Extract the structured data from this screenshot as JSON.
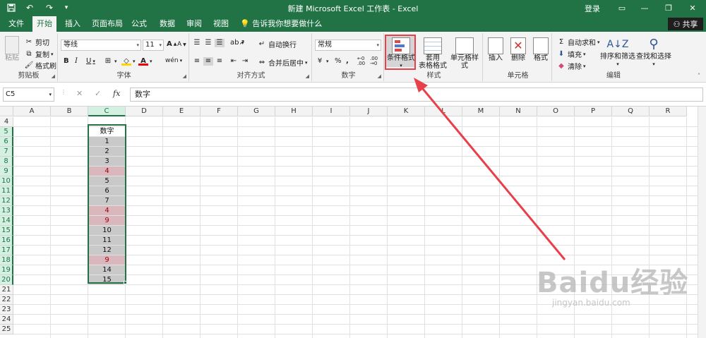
{
  "title_bar": {
    "title": "新建 Microsoft Excel 工作表 - Excel",
    "login": "登录",
    "quick_access": [
      "save-icon",
      "undo-icon",
      "redo-icon",
      "customize-icon"
    ]
  },
  "tabs": [
    "文件",
    "开始",
    "插入",
    "页面布局",
    "公式",
    "数据",
    "审阅",
    "视图"
  ],
  "active_tab": "开始",
  "tell_me": "告诉我你想要做什么",
  "share": "共享",
  "ribbon": {
    "clipboard": {
      "label": "剪贴板",
      "paste": "粘贴",
      "cut": "剪切",
      "copy": "复制",
      "format_painter": "格式刷"
    },
    "font": {
      "label": "字体",
      "font_name": "等线",
      "font_size": "11",
      "bold": "B",
      "italic": "I",
      "underline": "U",
      "grow": "A",
      "shrink": "A",
      "wen": "wén"
    },
    "alignment": {
      "label": "对齐方式",
      "wrap": "自动换行",
      "merge": "合并后居中"
    },
    "number": {
      "label": "数字",
      "format": "常规",
      "percent": "%",
      "comma": ",",
      "inc": "←0 .00",
      "dec": ".00 →0"
    },
    "styles": {
      "label": "样式",
      "conditional": "条件格式",
      "table_line1": "套用",
      "table_line2": "表格格式",
      "cell_styles": "单元格样式"
    },
    "cells": {
      "label": "单元格",
      "insert": "插入",
      "delete": "删除",
      "format": "格式"
    },
    "editing": {
      "label": "编辑",
      "autosum": "自动求和",
      "fill": "填充",
      "clear": "清除",
      "sort": "排序和筛选",
      "find": "查找和选择"
    }
  },
  "formula_bar": {
    "name_box": "C5",
    "formula": "数字",
    "fx": "fx"
  },
  "columns": [
    "A",
    "B",
    "C",
    "D",
    "E",
    "F",
    "G",
    "H",
    "I",
    "J",
    "K",
    "L",
    "M",
    "N",
    "O",
    "P",
    "Q",
    "R"
  ],
  "rows": [
    "4",
    "5",
    "6",
    "7",
    "8",
    "9",
    "10",
    "11",
    "12",
    "13",
    "14",
    "15",
    "16",
    "17",
    "18",
    "19",
    "20",
    "21",
    "22",
    "23",
    "24",
    "25"
  ],
  "selected_column": "C",
  "data_cells": [
    {
      "row": "5",
      "value": "数字",
      "style": "header"
    },
    {
      "row": "6",
      "value": "1",
      "style": "normal"
    },
    {
      "row": "7",
      "value": "2",
      "style": "normal"
    },
    {
      "row": "8",
      "value": "3",
      "style": "normal"
    },
    {
      "row": "9",
      "value": "4",
      "style": "hl"
    },
    {
      "row": "10",
      "value": "5",
      "style": "normal"
    },
    {
      "row": "11",
      "value": "6",
      "style": "normal"
    },
    {
      "row": "12",
      "value": "7",
      "style": "normal"
    },
    {
      "row": "13",
      "value": "4",
      "style": "hl"
    },
    {
      "row": "14",
      "value": "9",
      "style": "hl"
    },
    {
      "row": "15",
      "value": "10",
      "style": "normal"
    },
    {
      "row": "16",
      "value": "11",
      "style": "normal"
    },
    {
      "row": "17",
      "value": "12",
      "style": "normal"
    },
    {
      "row": "18",
      "value": "9",
      "style": "hl"
    },
    {
      "row": "19",
      "value": "14",
      "style": "normal"
    },
    {
      "row": "20",
      "value": "15",
      "style": "normal"
    }
  ],
  "colors": {
    "excel_green": "#217346",
    "duplicate_fill": "#d9b7bd",
    "duplicate_text": "#9c0006",
    "annotation_red": "#e8404a"
  },
  "watermark": {
    "logo": "Baidu经验",
    "url": "jingyan.baidu.com"
  }
}
